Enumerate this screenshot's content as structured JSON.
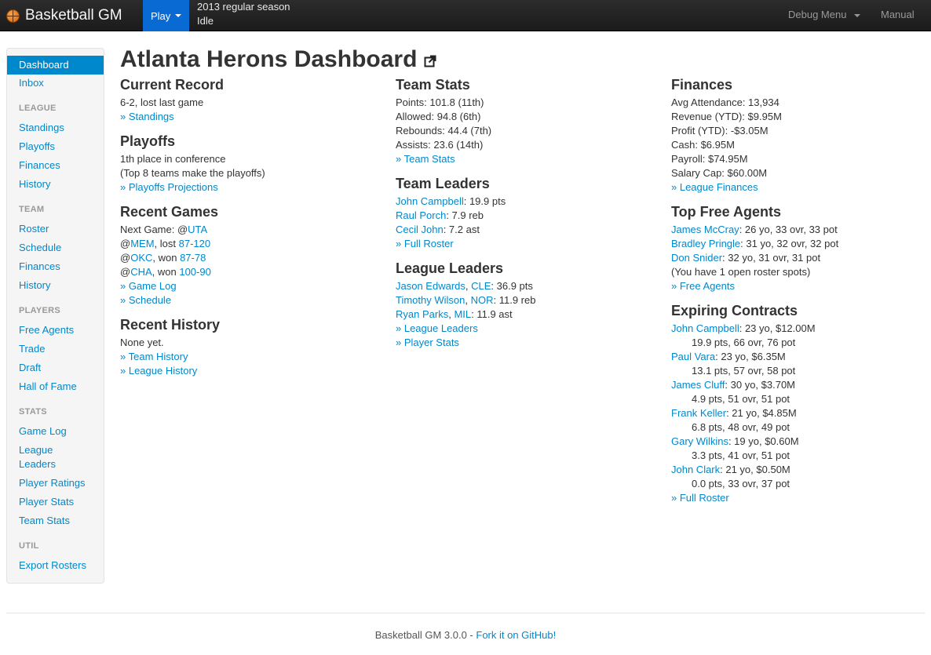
{
  "navbar": {
    "brand": "Basketball GM",
    "play": "Play",
    "season": "2013 regular season",
    "state": "Idle",
    "debug_menu": "Debug Menu",
    "manual": "Manual"
  },
  "sidebar": {
    "dashboard": "Dashboard",
    "inbox": "Inbox",
    "league_head": "LEAGUE",
    "standings": "Standings",
    "playoffs": "Playoffs",
    "finances": "Finances",
    "history": "History",
    "team_head": "TEAM",
    "roster": "Roster",
    "schedule": "Schedule",
    "team_finances": "Finances",
    "team_history": "History",
    "players_head": "PLAYERS",
    "free_agents": "Free Agents",
    "trade": "Trade",
    "draft": "Draft",
    "hall_of_fame": "Hall of Fame",
    "stats_head": "STATS",
    "game_log": "Game Log",
    "league_leaders_1": "League",
    "league_leaders_2": "Leaders",
    "player_ratings": "Player Ratings",
    "player_stats": "Player Stats",
    "team_stats": "Team Stats",
    "util_head": "UTIL",
    "export_rosters": "Export Rosters"
  },
  "page_title": "Atlanta Herons Dashboard",
  "current_record": {
    "heading": "Current Record",
    "text": "6-2, lost last game",
    "link": "» Standings"
  },
  "playoffs": {
    "heading": "Playoffs",
    "line1": "1th place in conference",
    "line2": "(Top 8 teams make the playoffs)",
    "link": "» Playoffs Projections"
  },
  "recent_games": {
    "heading": "Recent Games",
    "next_label": "Next Game: @",
    "next_team": "UTA",
    "games": [
      {
        "at": "@",
        "team": "MEM",
        "result": ", lost ",
        "score": "87-120"
      },
      {
        "at": "@",
        "team": "OKC",
        "result": ", won ",
        "score": "87-78"
      },
      {
        "at": "@",
        "team": "CHA",
        "result": ", won ",
        "score": "100-90"
      }
    ],
    "link_game_log": "» Game Log",
    "link_schedule": "» Schedule"
  },
  "recent_history": {
    "heading": "Recent History",
    "text": "None yet.",
    "link_team": "» Team History",
    "link_league": "» League History"
  },
  "team_stats": {
    "heading": "Team Stats",
    "points": "Points: 101.8 (11th)",
    "allowed": "Allowed: 94.8 (6th)",
    "rebounds": "Rebounds: 44.4 (7th)",
    "assists": "Assists: 23.6 (14th)",
    "link": "» Team Stats"
  },
  "team_leaders": {
    "heading": "Team Leaders",
    "leaders": [
      {
        "name": "John Campbell",
        "stat": ": 19.9 pts"
      },
      {
        "name": "Raul Porch",
        "stat": ": 7.9 reb"
      },
      {
        "name": "Cecil John",
        "stat": ": 7.2 ast"
      }
    ],
    "link": "» Full Roster"
  },
  "league_leaders": {
    "heading": "League Leaders",
    "leaders": [
      {
        "name": "Jason Edwards",
        "team": "CLE",
        "stat": ": 36.9 pts"
      },
      {
        "name": "Timothy Wilson",
        "team": "NOR",
        "stat": ": 11.9 reb"
      },
      {
        "name": "Ryan Parks",
        "team": "MIL",
        "stat": ": 11.9 ast"
      }
    ],
    "link_leaders": "» League Leaders",
    "link_stats": "» Player Stats"
  },
  "finances": {
    "heading": "Finances",
    "attendance": "Avg Attendance: 13,934",
    "revenue": "Revenue (YTD): $9.95M",
    "profit": "Profit (YTD): -$3.05M",
    "cash": "Cash: $6.95M",
    "payroll": "Payroll: $74.95M",
    "salary_cap": "Salary Cap: $60.00M",
    "link": "» League Finances"
  },
  "free_agents": {
    "heading": "Top Free Agents",
    "players": [
      {
        "name": "James McCray",
        "info": ": 26 yo, 33 ovr, 33 pot"
      },
      {
        "name": "Bradley Pringle",
        "info": ": 31 yo, 32 ovr, 32 pot"
      },
      {
        "name": "Don Snider",
        "info": ": 32 yo, 31 ovr, 31 pot"
      }
    ],
    "note": "(You have 1 open roster spots)",
    "link": "» Free Agents"
  },
  "expiring": {
    "heading": "Expiring Contracts",
    "players": [
      {
        "name": "John Campbell",
        "contract": ": 23 yo, $12.00M",
        "stats": "19.9 pts, 66 ovr, 76 pot"
      },
      {
        "name": "Paul Vara",
        "contract": ": 23 yo, $6.35M",
        "stats": "13.1 pts, 57 ovr, 58 pot"
      },
      {
        "name": "James Cluff",
        "contract": ": 30 yo, $3.70M",
        "stats": "4.9 pts, 51 ovr, 51 pot"
      },
      {
        "name": "Frank Keller",
        "contract": ": 21 yo, $4.85M",
        "stats": "6.8 pts, 48 ovr, 49 pot"
      },
      {
        "name": "Gary Wilkins",
        "contract": ": 19 yo, $0.60M",
        "stats": "3.3 pts, 41 ovr, 51 pot"
      },
      {
        "name": "John Clark",
        "contract": ": 21 yo, $0.50M",
        "stats": "0.0 pts, 33 ovr, 37 pot"
      }
    ],
    "link": "» Full Roster"
  },
  "footer": {
    "text": "Basketball GM 3.0.0 - ",
    "link": "Fork it on GitHub!"
  }
}
